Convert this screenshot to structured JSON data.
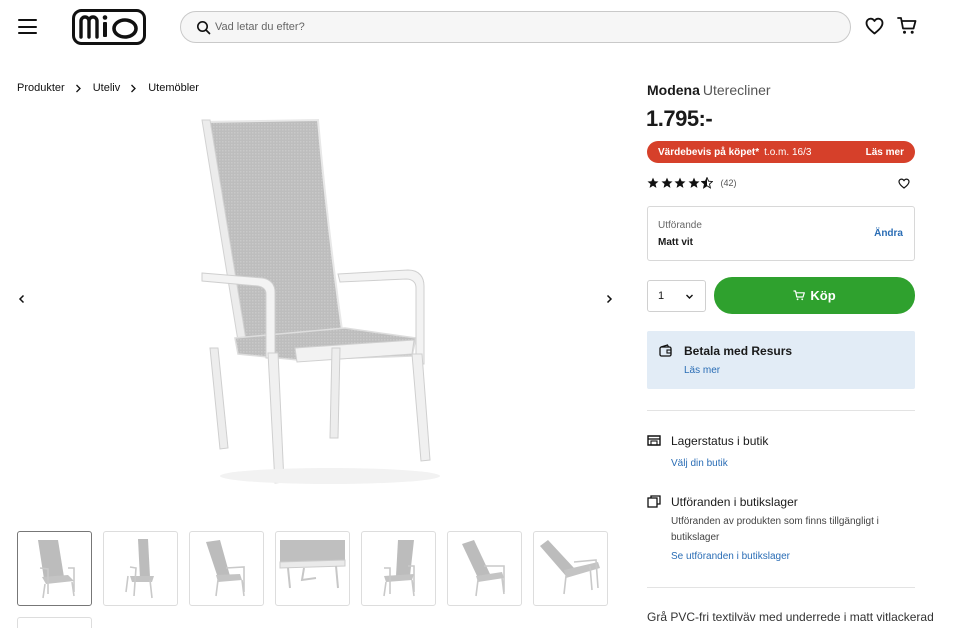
{
  "header": {
    "logo_text": "mio",
    "search_placeholder": "Vad letar du efter?"
  },
  "breadcrumb": [
    "Produkter",
    "Uteliv",
    "Utemöbler"
  ],
  "product": {
    "name": "Modena",
    "subtitle": "Uterecliner",
    "price": "1.795:-",
    "promo": {
      "label": "Värdebevis på köpet*",
      "date": "t.o.m. 16/3",
      "link": "Läs mer",
      "color": "#d6402a"
    },
    "rating": {
      "value": 4.5,
      "max": 5,
      "count": "(42)"
    },
    "variant": {
      "label": "Utförande",
      "value": "Matt vit",
      "change_label": "Ändra"
    },
    "quantity": "1",
    "buy_label": "Köp",
    "buy_color": "#2fa12e",
    "payment": {
      "title": "Betala med Resurs",
      "link": "Läs mer"
    },
    "store_stock": {
      "title": "Lagerstatus i butik",
      "link": "Välj din butik"
    },
    "store_variants": {
      "title": "Utföranden i butikslager",
      "text": "Utföranden av produkten som finns tillgängligt i butikslager",
      "link": "Se utföranden i butikslager"
    },
    "description": "Grå PVC-fri textilväv med underrede i matt vitlackerad"
  },
  "gallery": {
    "thumbnail_count": 7,
    "active_index": 0,
    "thumbnail_views": [
      "front-angle",
      "side",
      "reclined-front",
      "seat-detail",
      "front",
      "reclined-side",
      "fully-reclined"
    ]
  },
  "icons": [
    "menu-icon",
    "search-icon",
    "heart-icon",
    "cart-icon",
    "chevron-right-icon",
    "chevron-left-icon",
    "star-icon",
    "chevron-down-icon",
    "wallet-icon",
    "store-icon",
    "copy-icon"
  ]
}
